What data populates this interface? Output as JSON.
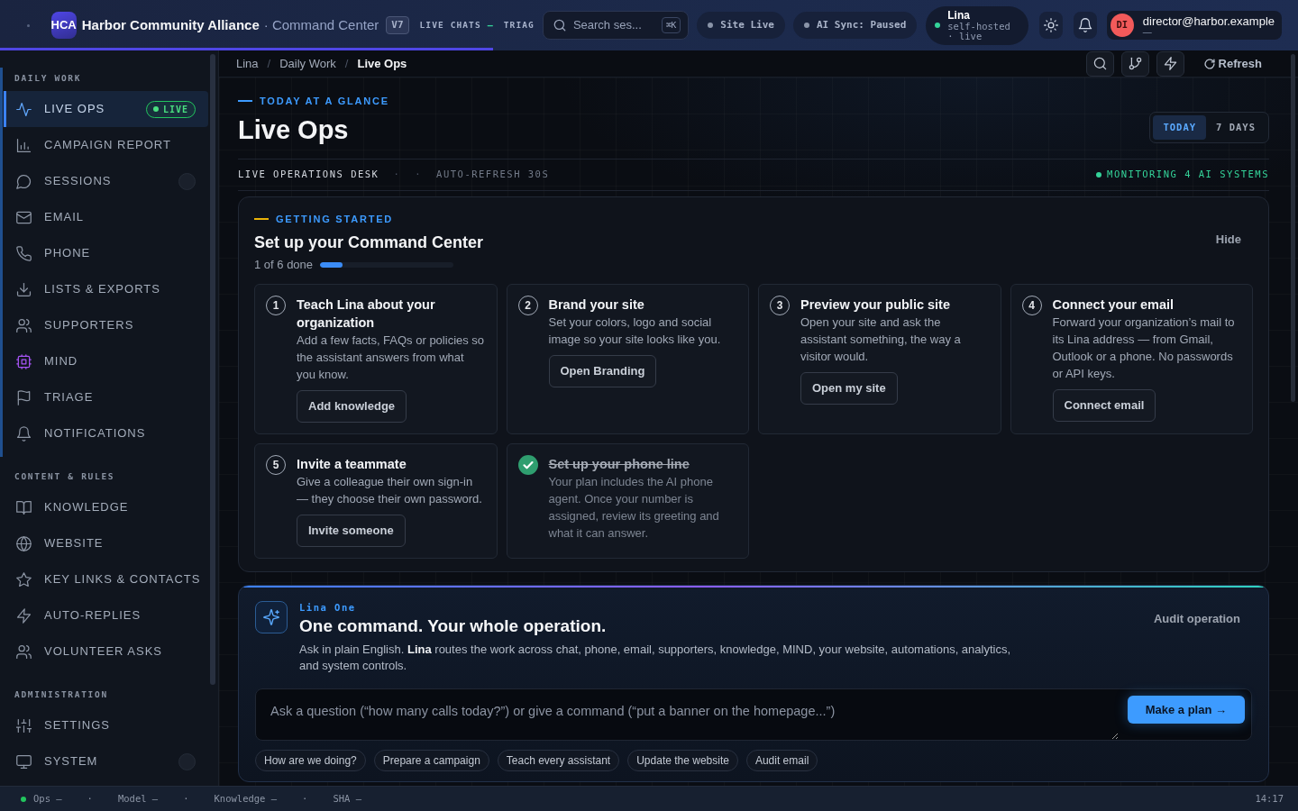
{
  "topbar": {
    "logo": "HCA",
    "org": "Harbor Community Alliance",
    "product": "· Command Center",
    "version": "V7",
    "nav": [
      {
        "label": "LIVE CHATS",
        "value": "—"
      },
      {
        "label": "TRIAG"
      }
    ],
    "search": {
      "placeholder": "Search ses...",
      "shortcut": "⌘K"
    },
    "status_pills": [
      {
        "label": "Site Live"
      },
      {
        "label": "AI Sync: Paused"
      }
    ],
    "assistant": {
      "name": "Lina",
      "detail": "self-hosted · live"
    },
    "user": {
      "initials": "DI",
      "email": "director@harbor.example",
      "role": "—"
    },
    "loading_bar": {
      "level": 0.38
    }
  },
  "sidebar": {
    "sections": [
      {
        "title": "DAILY WORK",
        "items": [
          {
            "label": "LIVE OPS",
            "selected": true,
            "badge": "LIVE"
          },
          {
            "label": "CAMPAIGN REPORT",
            "selected": false
          },
          {
            "label": "SESSIONS",
            "selected": false,
            "indicator": true
          },
          {
            "label": "EMAIL",
            "selected": false
          },
          {
            "label": "PHONE",
            "selected": false
          },
          {
            "label": "LISTS & EXPORTS",
            "selected": false
          },
          {
            "label": "SUPPORTERS",
            "selected": false
          },
          {
            "label": "MIND",
            "selected": false
          },
          {
            "label": "TRIAGE",
            "selected": false
          },
          {
            "label": "NOTIFICATIONS",
            "selected": false
          }
        ]
      },
      {
        "title": "CONTENT & RULES",
        "items": [
          {
            "label": "KNOWLEDGE",
            "selected": false
          },
          {
            "label": "WEBSITE",
            "selected": false
          },
          {
            "label": "KEY LINKS & CONTACTS",
            "selected": false
          },
          {
            "label": "AUTO-REPLIES",
            "selected": false
          },
          {
            "label": "VOLUNTEER ASKS",
            "selected": false
          }
        ]
      },
      {
        "title": "ADMINISTRATION",
        "items": [
          {
            "label": "SETTINGS",
            "selected": false
          },
          {
            "label": "SYSTEM",
            "selected": false,
            "indicator": true
          }
        ]
      }
    ]
  },
  "breadcrumb": {
    "items": [
      {
        "label": "Lina",
        "current": false
      },
      {
        "label": "Daily Work",
        "current": false
      },
      {
        "label": "Live Ops",
        "current": true
      }
    ],
    "separators": [
      "/",
      "/"
    ]
  },
  "toolbar": {
    "refresh": "Refresh"
  },
  "header": {
    "eyebrow": "TODAY AT A GLANCE",
    "title": "Live Ops",
    "range_tabs": [
      {
        "label": "TODAY",
        "selected": true
      },
      {
        "label": "7 DAYS",
        "selected": false
      }
    ],
    "meta": [
      {
        "kind": "primary",
        "text": "LIVE OPERATIONS DESK"
      },
      {
        "kind": "separator",
        "text": "·"
      },
      {
        "kind": "separator",
        "text": "·"
      },
      {
        "kind": "muted",
        "text": "AUTO-REFRESH 30S"
      }
    ],
    "monitoring": "MONITORING 4 AI SYSTEMS"
  },
  "setup": {
    "eyebrow": "GETTING STARTED",
    "title": "Set up your Command Center",
    "progress_text": "1 of 6 done",
    "level": 0.17,
    "hide": "Hide",
    "steps": [
      {
        "number": "1",
        "title": "Teach Lina about your organization",
        "text": "Add a few facts, FAQs or policies so the assistant answers from what you know.",
        "action": "Add knowledge",
        "done": false
      },
      {
        "number": "2",
        "title": "Brand your site",
        "text": "Set your colors, logo and social image so your site looks like you.",
        "action": "Open Branding",
        "done": false
      },
      {
        "number": "3",
        "title": "Preview your public site",
        "text": "Open your site and ask the assistant something, the way a visitor would.",
        "action": "Open my site",
        "done": false
      },
      {
        "number": "4",
        "title": "Connect your email",
        "text": "Forward your organization’s mail to its Lina address — from Gmail, Outlook or a phone. No passwords or API keys.",
        "action": "Connect email",
        "done": false
      },
      {
        "number": "5",
        "title": "Invite a teammate",
        "text": "Give a colleague their own sign-in — they choose their own password.",
        "action": "Invite someone",
        "done": false
      },
      {
        "title": "Set up your phone line",
        "text": "Your plan includes the AI phone agent. Once your number is assigned, review its greeting and what it can answer.",
        "done": true
      }
    ]
  },
  "command": {
    "eyebrow": "Lina One",
    "title": "One command. Your whole operation.",
    "text": "Ask in plain English. **Lina** routes the work across chat, phone, email, supporters, knowledge, MIND, your website, automations, analytics, and system controls.",
    "link": "Audit operation",
    "input": {
      "placeholder": "Ask a question (“how many calls today?”) or give a command (“put a banner on the homepage...”)"
    },
    "submit": "Make a plan →",
    "suggestions": [
      "How are we doing?",
      "Prepare a campaign",
      "Teach every assistant",
      "Update the website",
      "Audit email"
    ]
  },
  "status_bar": {
    "items": [
      {
        "kind": "status",
        "text": "Ops —",
        "color": "#22c55e"
      },
      {
        "kind": "separator",
        "text": "·"
      },
      {
        "kind": "status",
        "text": "Model —"
      },
      {
        "kind": "separator",
        "text": "·"
      },
      {
        "kind": "status",
        "text": "Knowledge —"
      },
      {
        "kind": "separator",
        "text": "·"
      },
      {
        "kind": "status",
        "text": "SHA —"
      }
    ],
    "time": "14:17"
  }
}
